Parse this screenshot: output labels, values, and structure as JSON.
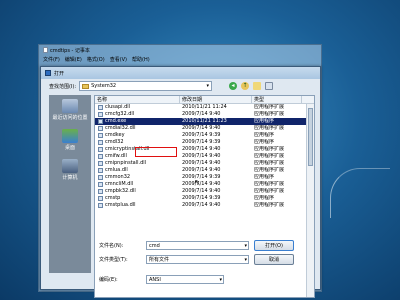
{
  "notepad": {
    "title": "cmdtips - 记事本",
    "menu": [
      "文件(F)",
      "编辑(E)",
      "格式(O)",
      "查看(V)",
      "帮助(H)"
    ]
  },
  "dialog": {
    "title": "打开",
    "look_in_label": "查找范围(I):",
    "look_in_value": "System32",
    "places": [
      {
        "label": "最近访问的位置",
        "icon": "recent-places-icon"
      },
      {
        "label": "桌面",
        "icon": "desktop-icon"
      },
      {
        "label": "计算机",
        "icon": "computer-icon"
      }
    ],
    "columns": {
      "name": "名称",
      "date": "修改日期",
      "type": "类型"
    },
    "files": [
      {
        "name": "clusapi.dll",
        "date": "2010/11/21 11:24",
        "type": "应用程序扩展"
      },
      {
        "name": "cmcfg32.dll",
        "date": "2009/7/14 9:40",
        "type": "应用程序扩展"
      },
      {
        "name": "cmd.exe",
        "date": "2010/11/21 11:23",
        "type": "应用程序"
      },
      {
        "name": "cmdial32.dll",
        "date": "2009/7/14 9:40",
        "type": "应用程序扩展"
      },
      {
        "name": "cmdkey",
        "date": "2009/7/14 9:39",
        "type": "应用程序"
      },
      {
        "name": "cmdl32",
        "date": "2009/7/14 9:39",
        "type": "应用程序"
      },
      {
        "name": "cmicryptinstall.dll",
        "date": "2009/7/14 9:40",
        "type": "应用程序扩展"
      },
      {
        "name": "cmifw.dll",
        "date": "2009/7/14 9:40",
        "type": "应用程序扩展"
      },
      {
        "name": "cmipnpinstall.dll",
        "date": "2009/7/14 9:40",
        "type": "应用程序扩展"
      },
      {
        "name": "cmlua.dll",
        "date": "2009/7/14 9:40",
        "type": "应用程序扩展"
      },
      {
        "name": "cmmon32",
        "date": "2009/7/14 9:39",
        "type": "应用程序"
      },
      {
        "name": "cmncliM.dll",
        "date": "2009/7/14 9:40",
        "type": "应用程序扩展"
      },
      {
        "name": "cmpbk32.dll",
        "date": "2009/7/14 9:40",
        "type": "应用程序扩展"
      },
      {
        "name": "cmstp",
        "date": "2009/7/14 9:39",
        "type": "应用程序"
      },
      {
        "name": "cmstplua.dll",
        "date": "2009/7/14 9:40",
        "type": "应用程序扩展"
      }
    ],
    "selected_index": 2,
    "filename_label": "文件名(N):",
    "filename_value": "cmd",
    "filetype_label": "文件类型(T):",
    "filetype_value": "所有文件",
    "encoding_label": "编码(E):",
    "encoding_value": "ANSI",
    "open_button": "打开(O)",
    "cancel_button": "取消"
  }
}
